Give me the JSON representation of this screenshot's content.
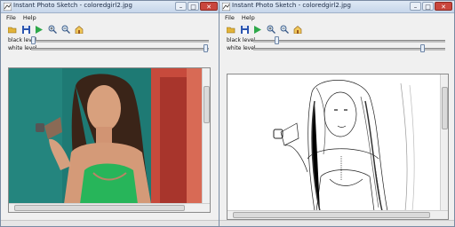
{
  "left_window": {
    "title": "Instant Photo Sketch - coloredgirl2.jpg",
    "menu": [
      "File",
      "Help"
    ],
    "toolbar": [
      "open-icon",
      "save-icon",
      "play-icon",
      "zoom-in-icon",
      "zoom-out-icon",
      "home-icon"
    ],
    "black_level": {
      "label": "black level",
      "value": 0.0
    },
    "white_level": {
      "label": "white level",
      "value": 1.0
    },
    "image_kind": "color photo"
  },
  "right_window": {
    "title": "Instant Photo Sketch - coloredgirl2.jpg",
    "menu": [
      "File",
      "Help"
    ],
    "toolbar": [
      "open-icon",
      "save-icon",
      "play-icon",
      "zoom-in-icon",
      "zoom-out-icon",
      "home-icon"
    ],
    "black_level": {
      "label": "black level",
      "value": 0.1
    },
    "white_level": {
      "label": "white level",
      "value": 0.9
    },
    "image_kind": "pencil sketch"
  },
  "colors": {
    "title_bg": "#c6d6ea",
    "close_button": "#c9463d",
    "photo_wall": "#1e7a74",
    "photo_door": "#c74a3c",
    "photo_top": "#27b55a"
  }
}
